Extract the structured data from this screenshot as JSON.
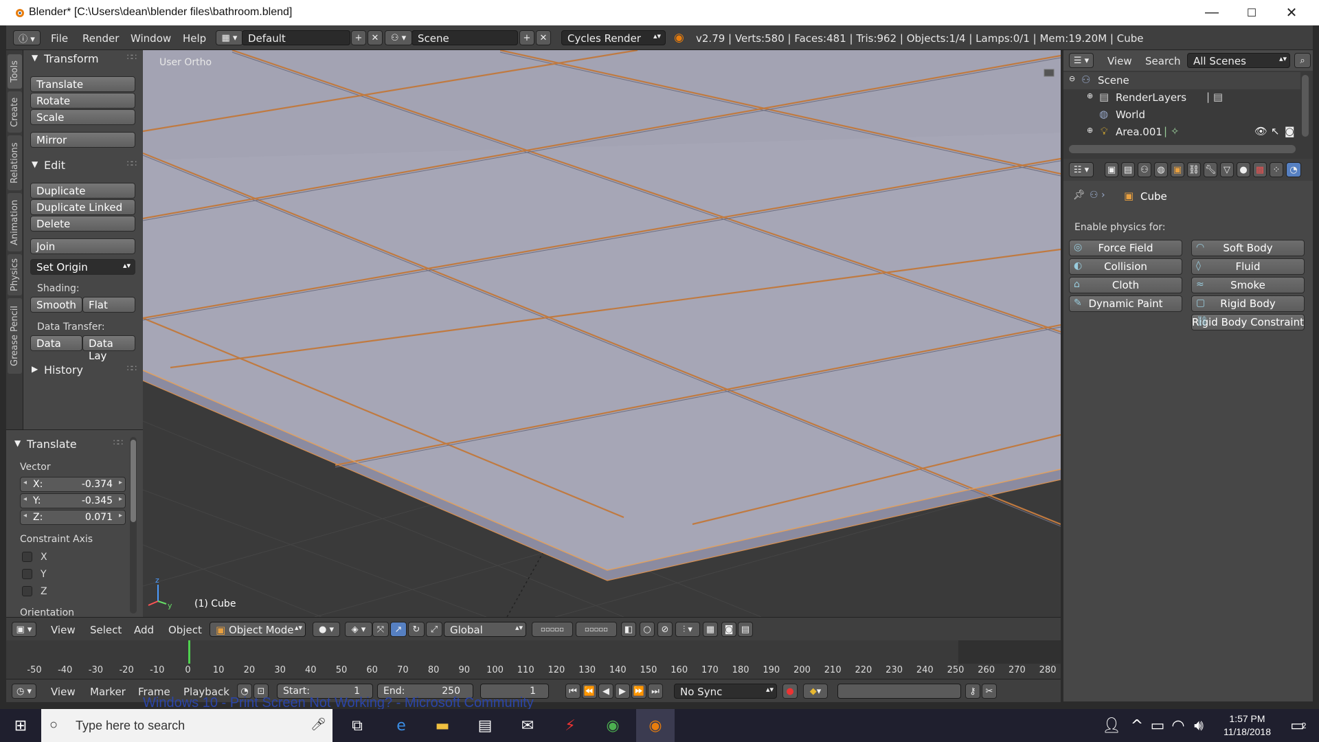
{
  "window": {
    "title": "Blender* [C:\\Users\\dean\\blender files\\bathroom.blend]",
    "controls": [
      "—",
      "☐",
      "✕"
    ]
  },
  "infobar": {
    "menus": [
      "File",
      "Render",
      "Window",
      "Help"
    ],
    "layout": "Default",
    "scene": "Scene",
    "engine": "Cycles Render",
    "stats": "v2.79 | Verts:580 | Faces:481 | Tris:962 | Objects:1/4 | Lamps:0/1 | Mem:19.20M | Cube"
  },
  "tool_tabs": [
    "Tools",
    "Create",
    "Relations",
    "Animation",
    "Physics",
    "Grease Pencil"
  ],
  "toolshelf": {
    "transform_header": "Transform",
    "translate": "Translate",
    "rotate": "Rotate",
    "scale": "Scale",
    "mirror": "Mirror",
    "edit_header": "Edit",
    "duplicate": "Duplicate",
    "duplicate_linked": "Duplicate Linked",
    "delete": "Delete",
    "join": "Join",
    "set_origin": "Set Origin",
    "shading_label": "Shading:",
    "smooth": "Smooth",
    "flat": "Flat",
    "data_transfer_label": "Data Transfer:",
    "data": "Data",
    "data_lay": "Data Lay",
    "history_header": "History"
  },
  "redo_panel": {
    "header": "Translate",
    "vector_label": "Vector",
    "x_label": "X:",
    "x_value": "-0.374",
    "y_label": "Y:",
    "y_value": "-0.345",
    "z_label": "Z:",
    "z_value": "0.071",
    "constraint_label": "Constraint Axis",
    "axis_x": "X",
    "axis_y": "Y",
    "axis_z": "Z",
    "orientation_label": "Orientation"
  },
  "viewport": {
    "view_name": "User Ortho",
    "active_object": "(1) Cube"
  },
  "viewport_header": {
    "menus": [
      "View",
      "Select",
      "Add",
      "Object"
    ],
    "mode": "Object Mode",
    "orientation": "Global"
  },
  "timeline": {
    "ticks": [
      "-50",
      "-40",
      "-30",
      "-20",
      "-10",
      "0",
      "10",
      "20",
      "30",
      "40",
      "50",
      "60",
      "70",
      "80",
      "90",
      "100",
      "110",
      "120",
      "130",
      "140",
      "150",
      "160",
      "170",
      "180",
      "190",
      "200",
      "210",
      "220",
      "230",
      "240",
      "250",
      "260",
      "270",
      "280"
    ],
    "menus": [
      "View",
      "Marker",
      "Frame",
      "Playback"
    ],
    "start_label": "Start:",
    "start_value": "1",
    "end_label": "End:",
    "end_value": "250",
    "current_frame": "1",
    "sync": "No Sync"
  },
  "behind_window_text": "Windows 10 - Print Screen Not Working? - Microsoft Community",
  "outliner": {
    "menus": [
      "View",
      "Search"
    ],
    "filter": "All Scenes",
    "items": [
      "Scene",
      "RenderLayers",
      "World",
      "Area.001"
    ]
  },
  "properties": {
    "context": "Cube",
    "enable_label": "Enable physics for:",
    "buttons_left": [
      "Force Field",
      "Collision",
      "Cloth",
      "Dynamic Paint"
    ],
    "buttons_right": [
      "Soft Body",
      "Fluid",
      "Smoke",
      "Rigid Body",
      "Rigid Body Constraint"
    ]
  },
  "taskbar": {
    "search_placeholder": "Type here to search",
    "time": "1:57 PM",
    "date": "11/18/2018",
    "notifications": "2"
  },
  "colors": {
    "tile": "#a4a4b4",
    "grout": "#c07a40",
    "blender_bg": "#393939",
    "accent": "#5680c2"
  }
}
